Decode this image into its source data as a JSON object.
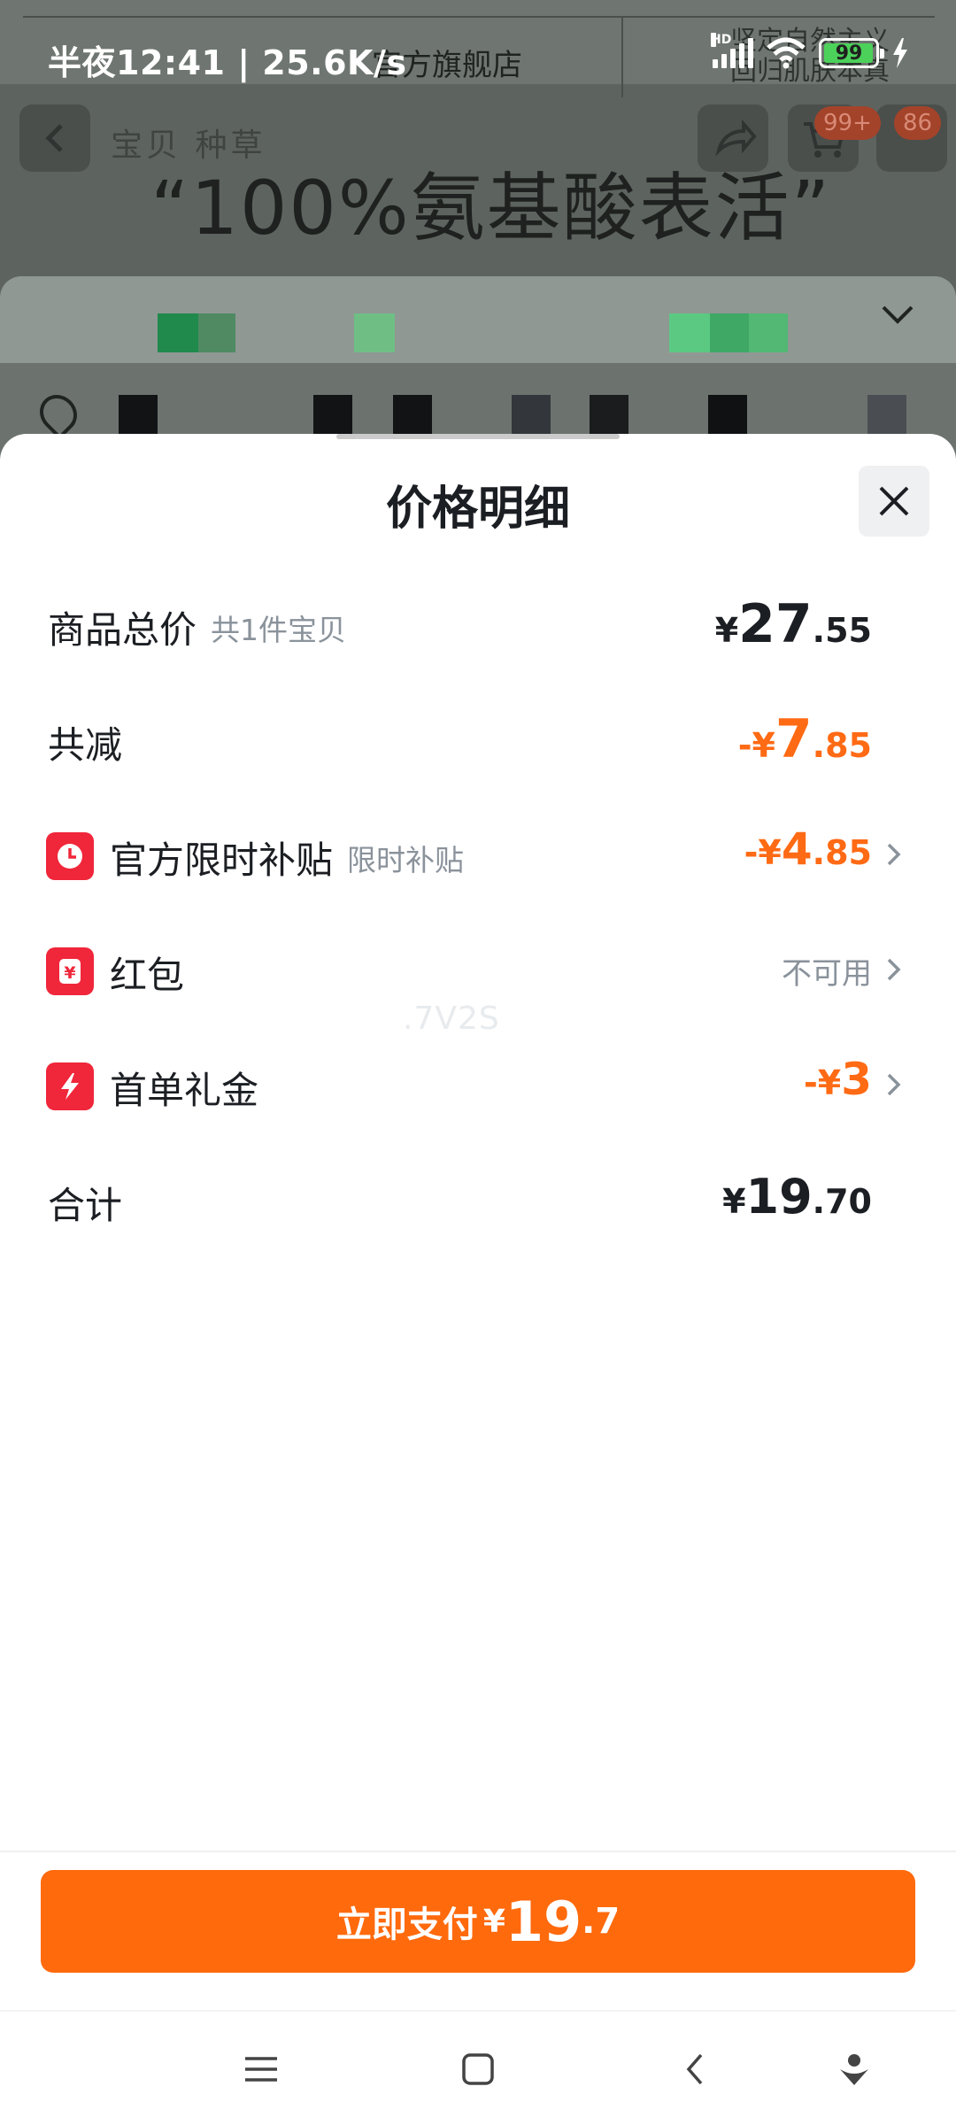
{
  "status_bar": {
    "time_text": "半夜12:41 | 25.6K/s",
    "battery_level": "99",
    "network_label": "HD"
  },
  "background_page": {
    "store_name": "官方旗舰店",
    "promo_right_line1": "坚定自然主义",
    "promo_right_line2": "回归肌肤本真",
    "nav_tabs": "宝贝  种草",
    "slogan": "“100%氨基酸表活”",
    "cart_badge": "99+",
    "more_badge": "86"
  },
  "sheet": {
    "title": "价格明细",
    "rows": {
      "total": {
        "label": "商品总价",
        "sub": "共1件宝贝",
        "currency": "¥",
        "int": "27",
        "dec": ".55"
      },
      "discount": {
        "label": "共减",
        "prefix": "-",
        "currency": "¥",
        "int": "7",
        "dec": ".85"
      },
      "subsidy": {
        "icon": "clock-icon",
        "label": "官方限时补贴",
        "sub": "限时补贴",
        "prefix": "-",
        "currency": "¥",
        "int": "4",
        "dec": ".85"
      },
      "red_packet": {
        "icon": "yen-icon",
        "label": "红包",
        "status": "不可用"
      },
      "first_gift": {
        "icon": "lightning-icon",
        "label": "首单礼金",
        "prefix": "-",
        "currency": "¥",
        "int": "3"
      },
      "sum": {
        "label": "合计",
        "currency": "¥",
        "int": "19",
        "dec": ".70"
      }
    },
    "watermark": ".7V2S"
  },
  "pay": {
    "label": "立即支付",
    "currency": "¥",
    "int": "19",
    "dec": ".7"
  },
  "colors": {
    "accent_orange": "#ff6a0d",
    "price_orange": "#ff6a14",
    "icon_red": "#f0263a",
    "battery_green": "#4cd15a"
  }
}
